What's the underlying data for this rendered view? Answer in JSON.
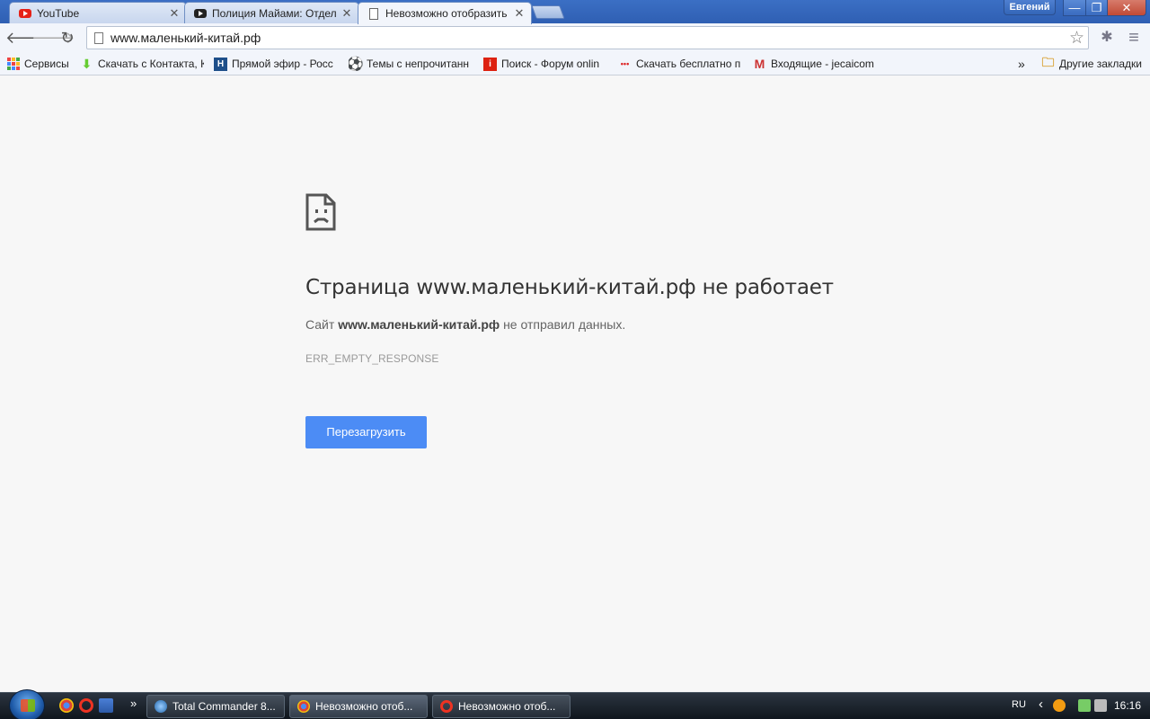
{
  "window": {
    "user_name": "Евгений",
    "minimize": "—",
    "restore": "❐",
    "close": "✕"
  },
  "tabs": [
    {
      "title": "YouTube",
      "icon": "youtube-icon"
    },
    {
      "title": "Полиция Майами: Отдел",
      "icon": "youtube-dark-icon"
    },
    {
      "title": "Невозможно отобразить",
      "icon": "page-icon",
      "active": true
    }
  ],
  "tab_close": "✕",
  "toolbar": {
    "back": "🡐",
    "forward": "🡒",
    "reload": "↻",
    "url": "www.маленький-китай.рф",
    "star": "☆",
    "ext1": "✱",
    "menu": "≡"
  },
  "bookmarks": {
    "items": [
      {
        "label": "Сервисы"
      },
      {
        "label": "Скачать с Контакта, К"
      },
      {
        "label": "Прямой эфир - Росс"
      },
      {
        "label": "Темы с непрочитанн"
      },
      {
        "label": "Поиск - Форум onlin"
      },
      {
        "label": "Скачать бесплатно п"
      },
      {
        "label": "Входящие - jecaicom"
      }
    ],
    "more": "»",
    "other_label": "Другие закладки"
  },
  "error": {
    "title": "Страница www.маленький-китай.рф не работает",
    "desc_prefix": "Сайт ",
    "desc_site": "www.маленький-китай.рф",
    "desc_suffix": " не отправил данных.",
    "code": "ERR_EMPTY_RESPONSE",
    "reload_label": "Перезагрузить"
  },
  "taskbar": {
    "more": "»",
    "tasks": [
      {
        "label": "Total Commander 8..."
      },
      {
        "label": "Невозможно отоб..."
      },
      {
        "label": "Невозможно отоб..."
      }
    ],
    "lang": "RU",
    "tray_arrow": "‹",
    "time": "16:16"
  }
}
